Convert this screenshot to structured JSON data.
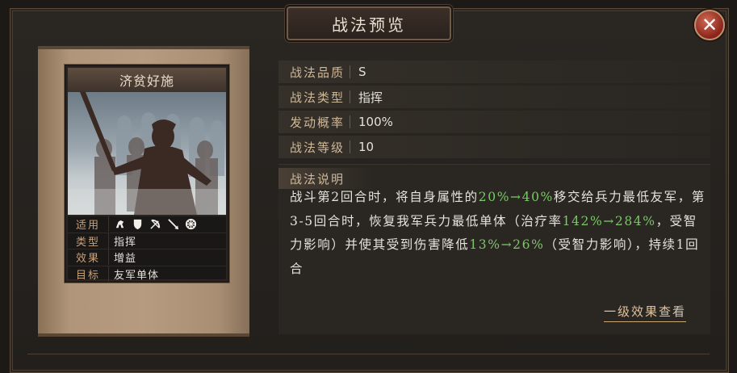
{
  "dialog": {
    "title": "战法预览",
    "close_icon": "close-icon"
  },
  "card": {
    "name": "济贫好施",
    "stats": [
      {
        "key": "适用",
        "icons": [
          "cavalry-icon",
          "shield-icon",
          "bow-icon",
          "spear-icon",
          "wheel-icon"
        ]
      },
      {
        "key": "类型",
        "value": "指挥"
      },
      {
        "key": "效果",
        "value": "增益"
      },
      {
        "key": "目标",
        "value": "友军单体"
      }
    ]
  },
  "properties": [
    {
      "key": "战法品质",
      "value": "S"
    },
    {
      "key": "战法类型",
      "value": "指挥"
    },
    {
      "key": "发动概率",
      "value": "100%"
    },
    {
      "key": "战法等级",
      "value": "10"
    }
  ],
  "description": {
    "label": "战法说明",
    "segments": [
      {
        "t": "战斗第2回合时，将自身属性的"
      },
      {
        "t": "20%→40%",
        "hl": true
      },
      {
        "t": "移交给兵力最低友军，第3-5回合时，恢复我军兵力最低单体（治疗率"
      },
      {
        "t": "142%→284%",
        "hl": true
      },
      {
        "t": "，受智力影响）并使其受到伤害降低"
      },
      {
        "t": "13%→26%",
        "hl": true
      },
      {
        "t": "（受智力影响），持续1回合"
      }
    ]
  },
  "footer": {
    "link_label": "一级效果查看"
  },
  "colors": {
    "highlight": "#7bc86a",
    "label": "#cfb898",
    "close": "#8a2318"
  }
}
